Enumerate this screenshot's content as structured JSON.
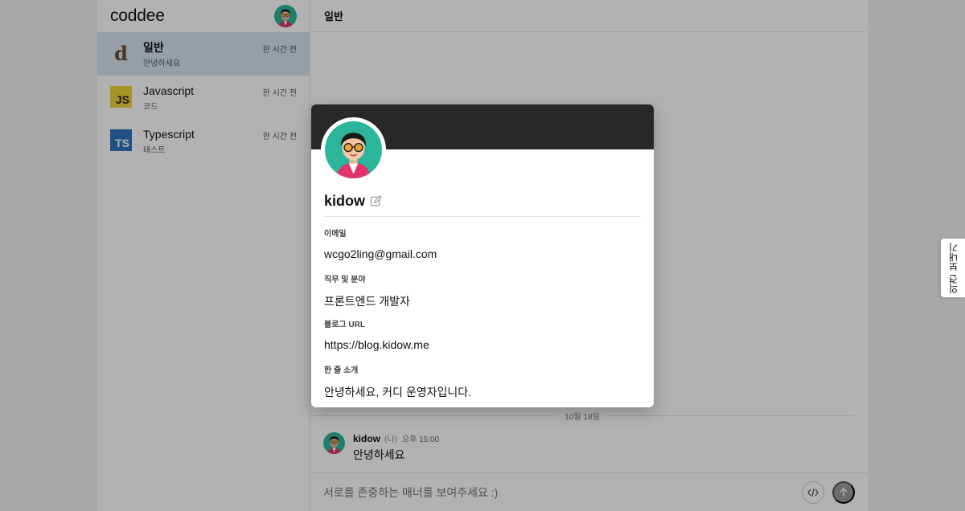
{
  "brand": {
    "name": "coddee"
  },
  "channels": [
    {
      "name": "일반",
      "preview": "안녕하세요",
      "time": "한 시간 전",
      "icon": "d",
      "icon_name": "coddee-logo-icon"
    },
    {
      "name": "Javascript",
      "preview": "코드",
      "time": "한 시간 전",
      "icon": "JS",
      "icon_name": "javascript-icon"
    },
    {
      "name": "Typescript",
      "preview": "테스트",
      "time": "한 시간 전",
      "icon": "TS",
      "icon_name": "typescript-icon"
    }
  ],
  "main": {
    "title": "일반",
    "date_separator": "10월 18일",
    "message": {
      "author": "kidow",
      "me_tag": "(나)",
      "time": "오후 15:00",
      "text": "안녕하세요"
    },
    "composer_placeholder": "서로를 존중하는 매너를 보여주세요 :)"
  },
  "profile": {
    "name": "kidow",
    "fields": [
      {
        "label": "이메일",
        "value": "wcgo2ling@gmail.com"
      },
      {
        "label": "직무 및 분야",
        "value": "프론트엔드 개발자"
      },
      {
        "label": "블로그 URL",
        "value": "https://blog.kidow.me"
      },
      {
        "label": "한 줄 소개",
        "value": "안녕하세요, 커디 운영자입니다."
      }
    ]
  },
  "feedback": {
    "label": "의견 보내기"
  },
  "colors": {
    "banner": "#282828",
    "active_channel": "#d7e2f0",
    "js": "#f0d43a",
    "ts": "#2f74c0",
    "avatar_bg": "#2bb59a"
  }
}
